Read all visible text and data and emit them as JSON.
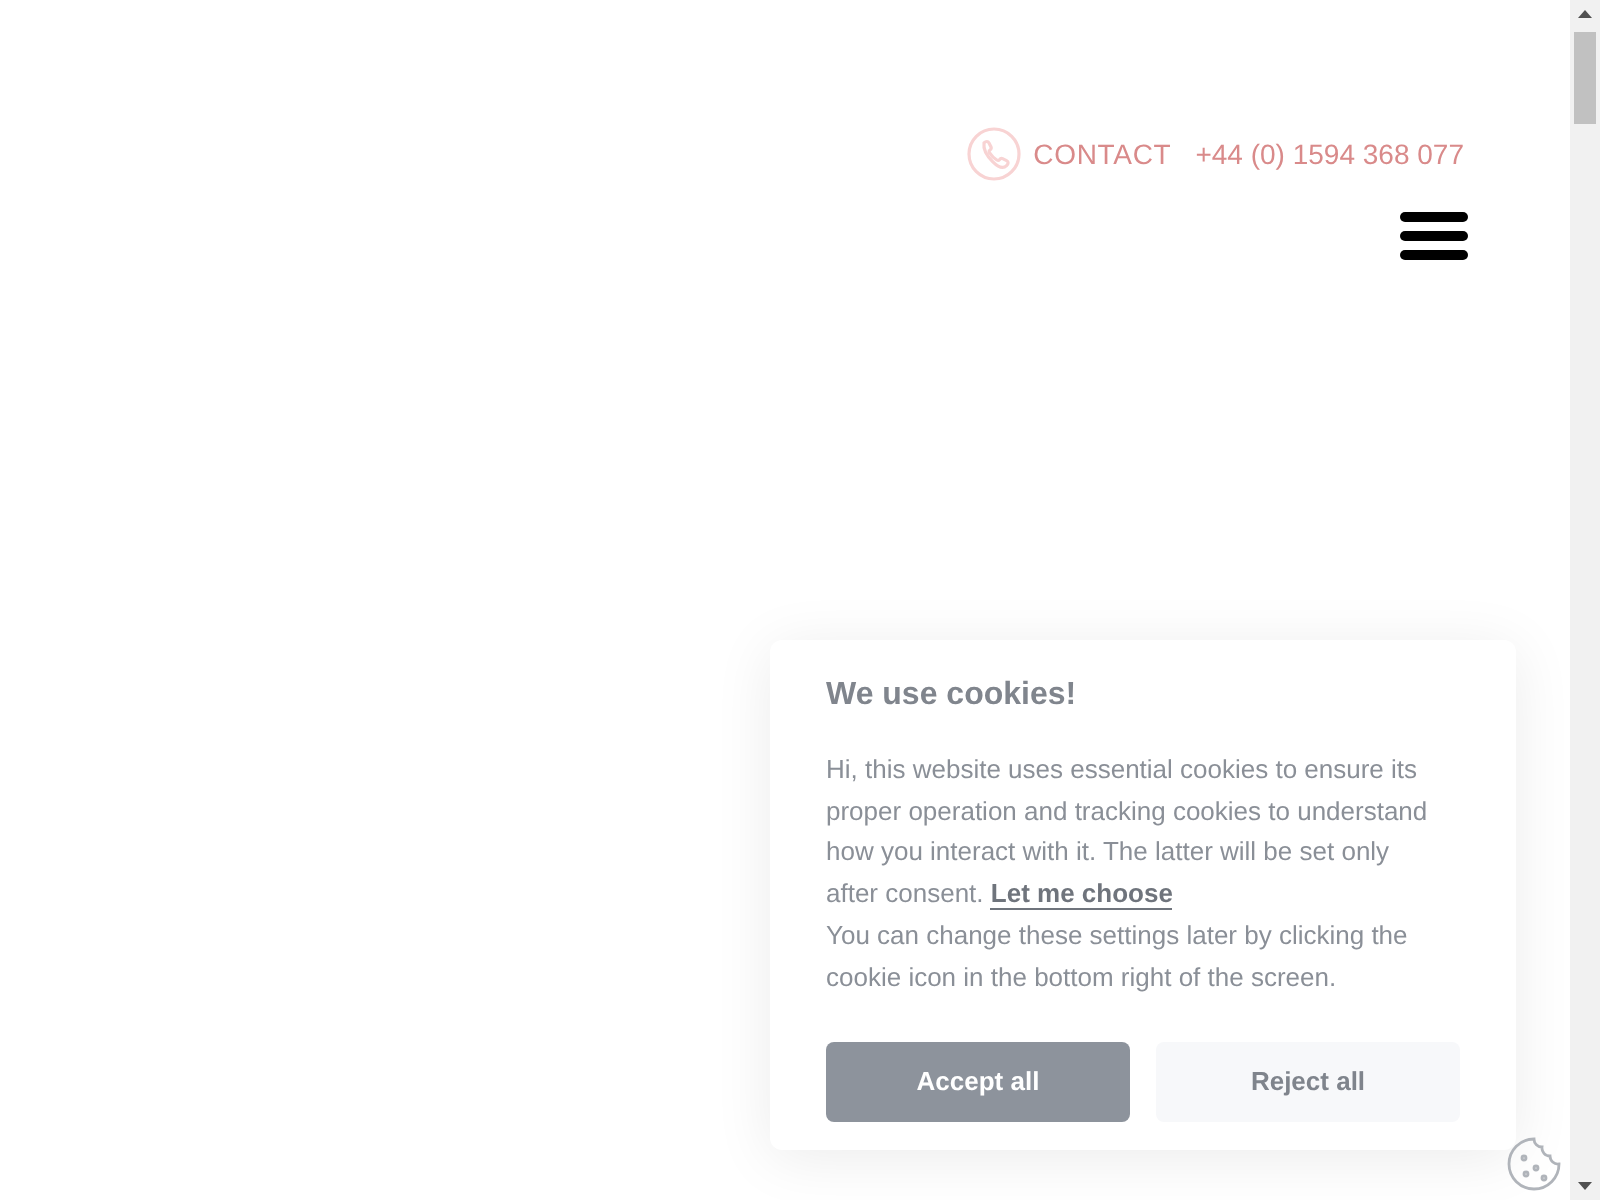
{
  "header": {
    "contact_label": "CONTACT",
    "phone": "+44 (0) 1594 368 077"
  },
  "cookie_banner": {
    "title": "We use cookies!",
    "body": "Hi, this website uses essential cookies to ensure its proper operation and tracking cookies to understand how you interact with it. The latter will be set only after consent.",
    "link": "Let me choose",
    "note": "You can change these settings later by clicking the cookie icon in the bottom right of the screen.",
    "buttons": [
      {
        "label": "Accept all",
        "kind": "primary"
      },
      {
        "label": "Reject all",
        "kind": "secondary"
      }
    ]
  }
}
